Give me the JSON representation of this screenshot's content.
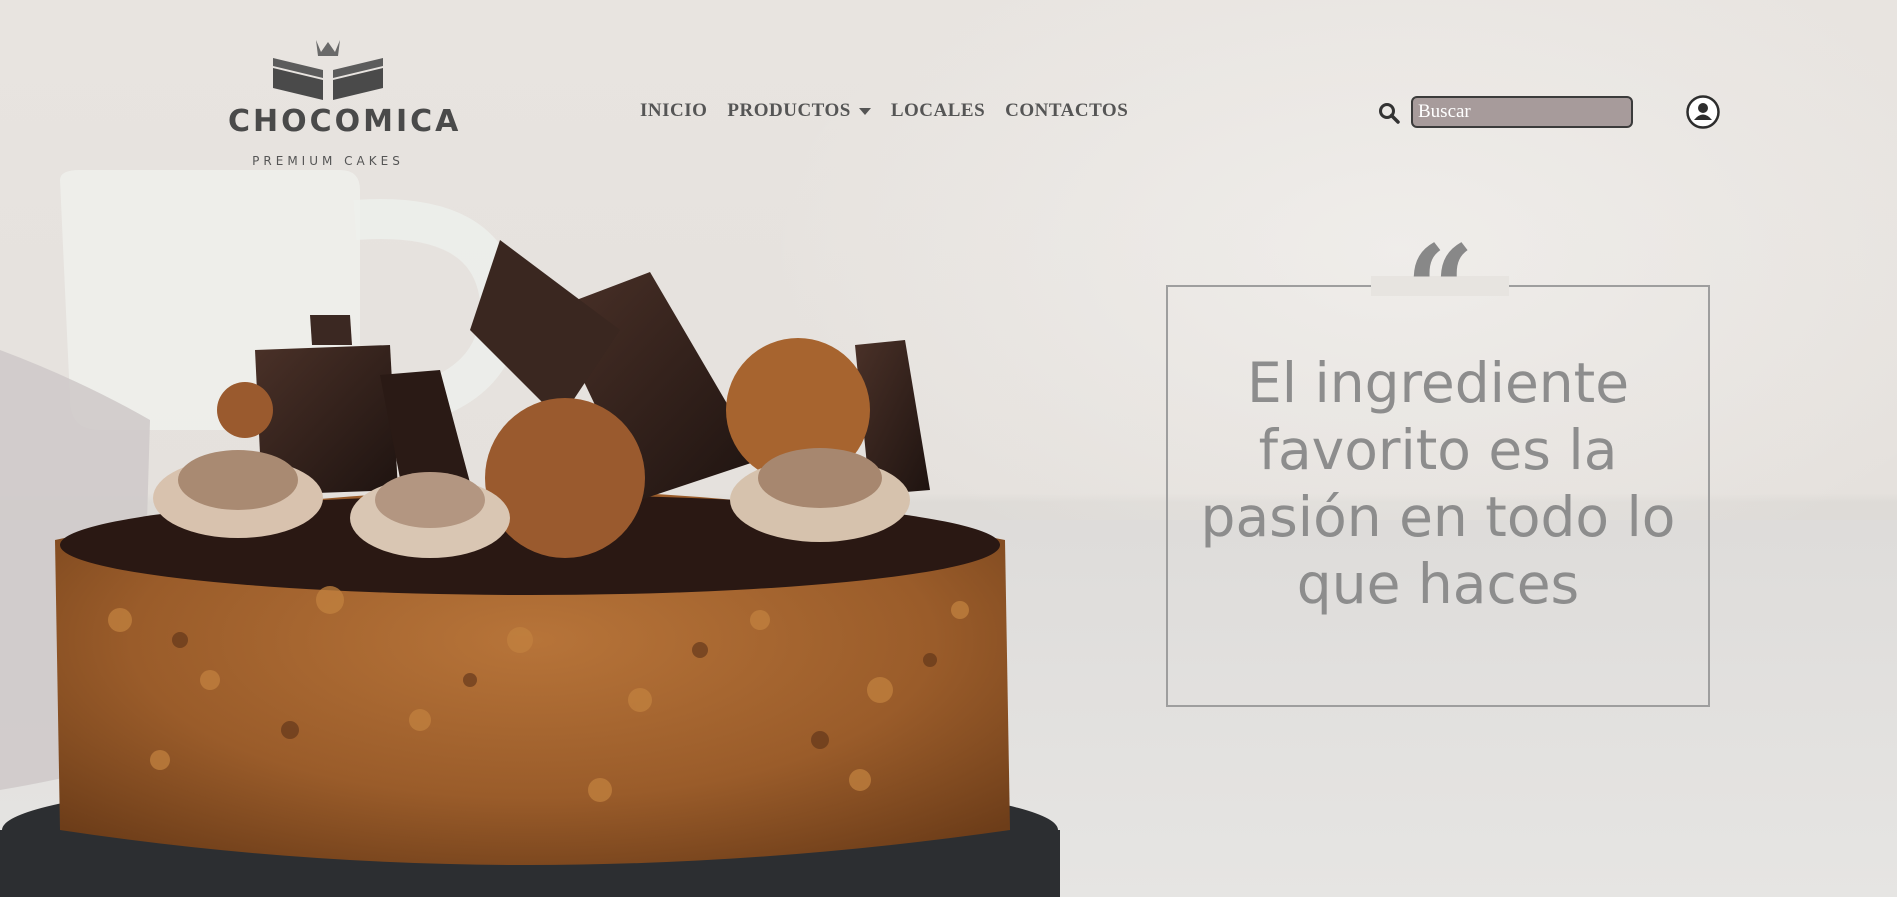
{
  "brand": {
    "name": "CHOCOMICA",
    "tagline": "PREMIUM CAKES",
    "icon": "cake-slices-logo"
  },
  "nav": {
    "items": [
      {
        "label": "INICIO"
      },
      {
        "label": "PRODUCTOS",
        "has_dropdown": true
      },
      {
        "label": "LOCALES"
      },
      {
        "label": "CONTACTOS"
      }
    ]
  },
  "search": {
    "icon": "search-icon",
    "placeholder": "Buscar"
  },
  "user": {
    "icon": "user-circle-icon"
  },
  "hero": {
    "image": "chocolate-cake-photo",
    "quote_mark": "“",
    "quote": "El ingrediente favorito es la pasión en todo lo que haces"
  },
  "colors": {
    "nav_text": "#555555",
    "search_bg": "#a79b9b",
    "quote_text": "#8d8d8d",
    "quote_border": "#9e9e9e",
    "background": "#e9e6e2"
  }
}
